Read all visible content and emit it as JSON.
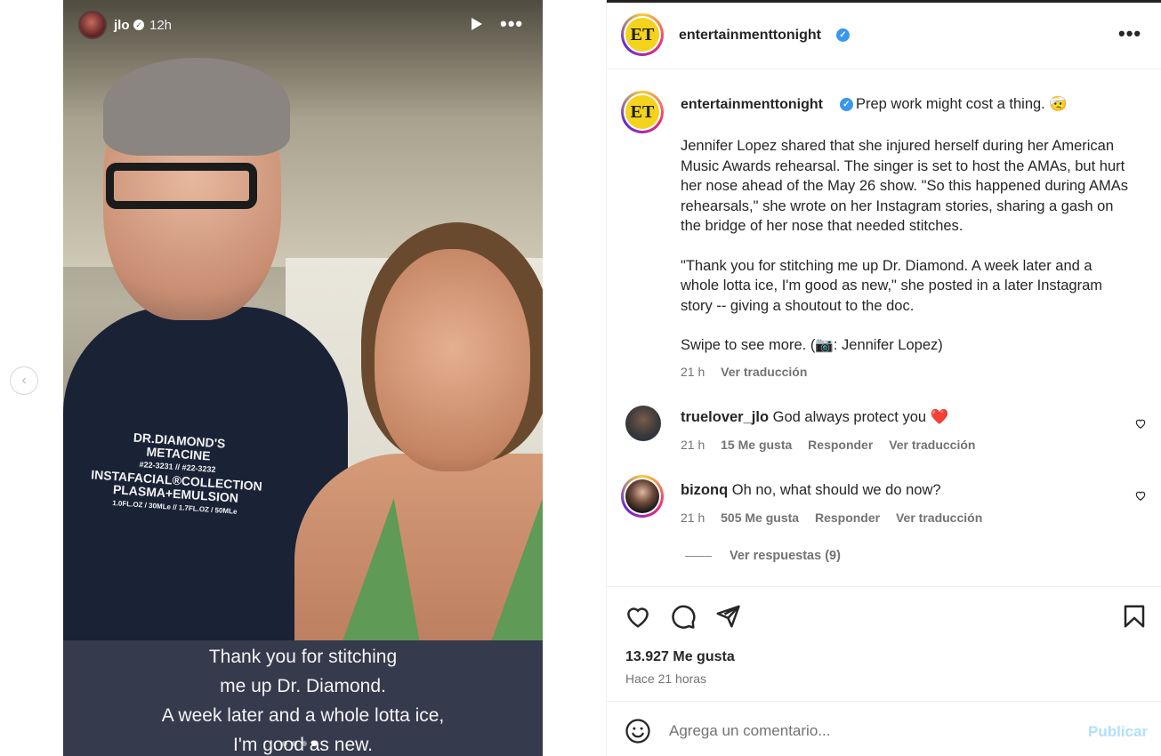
{
  "story": {
    "username": "jlo",
    "time": "12h",
    "shirt_text": [
      "DR.DIAMOND'S",
      "METACINE",
      "#22-3231 // #22-3232",
      "INSTAFACIAL®COLLECTION",
      "PLASMA+EMULSION",
      "1.0FL.OZ / 30MLe // 1.7FL.OZ / 50MLe"
    ],
    "caption_lines": [
      "Thank you for stitching",
      "me up Dr. Diamond.",
      "A week later and a whole lotta ice,",
      "I'm good as new."
    ]
  },
  "post": {
    "author": "entertainmenttonight",
    "logo_text": "ET",
    "caption_lead": "Prep work might cost a thing. 🤕",
    "caption_paragraphs": [
      "Jennifer Lopez shared that she injured herself during her American Music Awards rehearsal. The singer is set to host the AMAs, but hurt her nose ahead of the May 26 show. \"So this happened during AMAs rehearsals,\" she wrote on her Instagram stories, sharing a gash on the bridge of her nose that needed stitches.",
      "\"Thank you for stitching me up Dr. Diamond. A week later and a whole lotta ice, I'm good as new,\" she posted in a later Instagram story -- giving a shoutout to the doc.",
      "Swipe to see more. (📷: Jennifer Lopez)"
    ],
    "caption_time": "21 h",
    "caption_translate": "Ver traducción"
  },
  "comments": [
    {
      "user": "truelover_jlo",
      "text": "God always protect you ❤️",
      "time": "21 h",
      "likes": "15 Me gusta",
      "reply": "Responder",
      "translate": "Ver traducción"
    },
    {
      "user": "bizonq",
      "text": "Oh no, what should we do now?",
      "time": "21 h",
      "likes": "505 Me gusta",
      "reply": "Responder",
      "translate": "Ver traducción"
    }
  ],
  "view_replies": "Ver respuestas (9)",
  "likes_count": "13.927 Me gusta",
  "posted_ago": "Hace 21 horas",
  "comment_box": {
    "placeholder": "Agrega un comentario...",
    "publish": "Publicar"
  },
  "colors": {
    "verified": "#3897f0",
    "accent_link": "#0095f6",
    "publish_disabled": "#b2dffc",
    "heart_red": "#ff3040"
  }
}
